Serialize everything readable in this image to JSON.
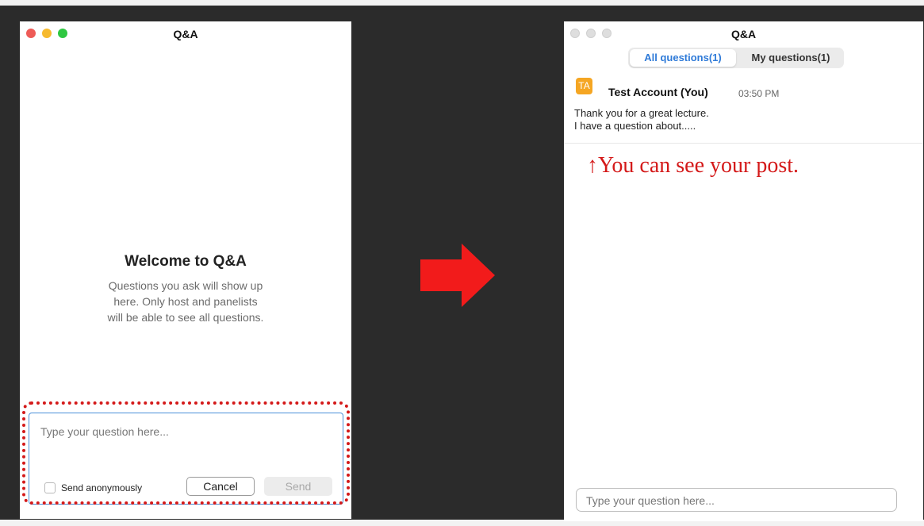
{
  "left_window": {
    "title": "Q&A",
    "welcome": {
      "heading": "Welcome to Q&A",
      "line1": "Questions you ask will show up",
      "line2": "here. Only host and panelists",
      "line3": "will be able to see all questions."
    },
    "composer": {
      "placeholder": "Type your question here...",
      "anonymous_label": "Send anonymously",
      "cancel_label": "Cancel",
      "send_label": "Send"
    }
  },
  "right_window": {
    "title": "Q&A",
    "tabs": {
      "all": "All questions(1)",
      "mine": "My questions(1)"
    },
    "question": {
      "avatar_initials": "TA",
      "author": "Test Account (You)",
      "time": "03:50 PM",
      "line1": "Thank you for a great lecture.",
      "line2": "I have a question about....."
    },
    "annotation": "↑You can see your post.",
    "input_placeholder": "Type your question here..."
  },
  "colors": {
    "annotation_red": "#d41919",
    "tab_active_blue": "#2e7ad8",
    "avatar_orange": "#f5a623",
    "input_focus_blue": "#4a90d9"
  },
  "icons": [
    "arrow-right-icon"
  ]
}
